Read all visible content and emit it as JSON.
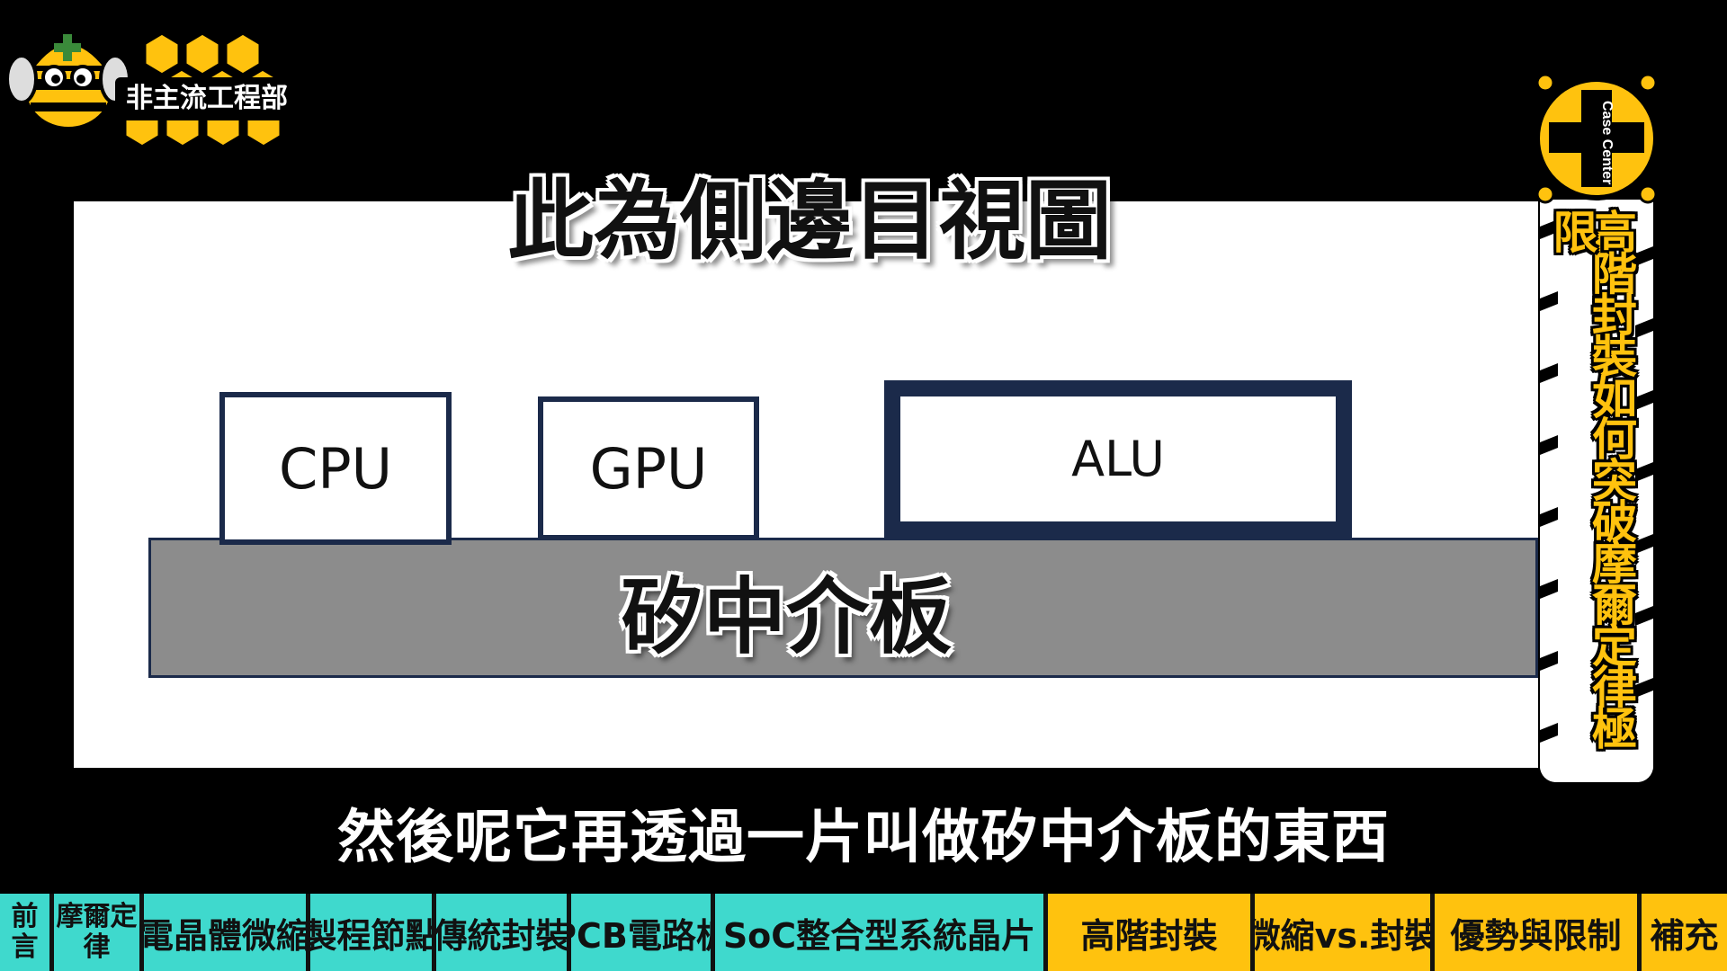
{
  "logo": {
    "label": "非主流工程部",
    "icon": "bee-icon"
  },
  "diagram": {
    "title": "此為側邊目視圖",
    "interposer_label": "矽中介板",
    "chips": {
      "cpu": "CPU",
      "gpu": "GPU",
      "alu": "ALU"
    }
  },
  "subtitle": "然後呢它再透過一片叫做矽中介板的東西",
  "banner": {
    "badge_text": "Case Center",
    "badge_icon": "cross-icon",
    "title": "高階封裝如何突破摩爾定律極限"
  },
  "chapters": [
    {
      "label": "前言",
      "active": false
    },
    {
      "label": "摩爾定律",
      "active": false
    },
    {
      "label": "電晶體微縮",
      "active": false
    },
    {
      "label": "製程節點",
      "active": false
    },
    {
      "label": "傳統封裝",
      "active": false
    },
    {
      "label": "PCB電路板",
      "active": false
    },
    {
      "label": "SoC整合型系統晶片",
      "active": false
    },
    {
      "label": "高階封裝",
      "active": true
    },
    {
      "label": "微縮vs.封裝",
      "active": true
    },
    {
      "label": "優勢與限制",
      "active": true
    },
    {
      "label": "補充",
      "active": true
    }
  ],
  "colors": {
    "chapter_past": "#3fd9cd",
    "chapter_current": "#ffc20e",
    "accent_yellow": "#ffc20e",
    "chip_border": "#1b2a4a",
    "interposer": "#8c8c8c"
  }
}
